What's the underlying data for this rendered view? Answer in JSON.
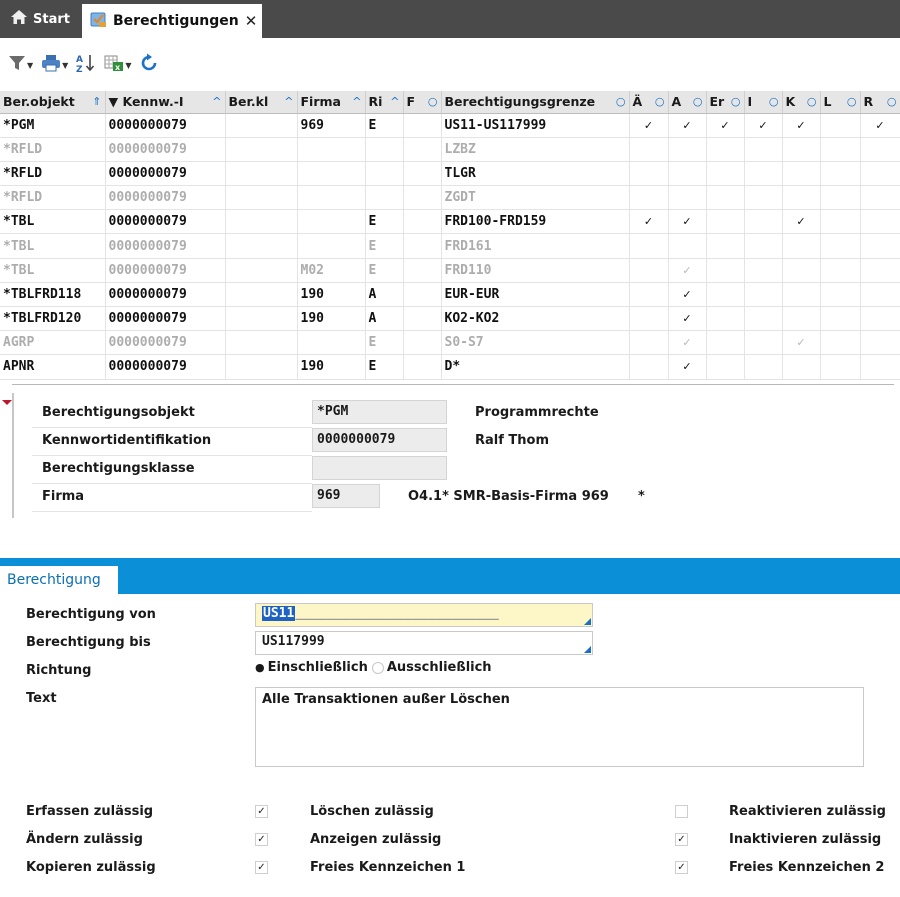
{
  "tabs": {
    "start_label": "Start",
    "active_label": "Berechtigungen",
    "close_glyph": "✕"
  },
  "toolbar": {
    "icons": [
      "filter-icon",
      "print-icon",
      "sort-az-icon",
      "export-excel-icon",
      "refresh-icon"
    ]
  },
  "grid": {
    "columns": [
      "Ber.objekt",
      "Kennw.-I",
      "Ber.kl",
      "Firma",
      "Ri",
      "F",
      "Berechtigungsgrenze",
      "Ä",
      "A",
      "Er",
      "I",
      "K",
      "L",
      "R"
    ],
    "rows": [
      {
        "obj": "*PGM",
        "kennw": "0000000079",
        "berkl": "",
        "firma": "969",
        "ri": "E",
        "f": "",
        "grenze": "US11-US117999",
        "chk": [
          "✓",
          "✓",
          "✓",
          "✓",
          "✓",
          "",
          "✓"
        ],
        "dim": false
      },
      {
        "obj": "*RFLD",
        "kennw": "0000000079",
        "berkl": "",
        "firma": "",
        "ri": "",
        "f": "",
        "grenze": "LZBZ",
        "chk": [
          "",
          "",
          "",
          "",
          "",
          "",
          ""
        ],
        "dim": true
      },
      {
        "obj": "*RFLD",
        "kennw": "0000000079",
        "berkl": "",
        "firma": "",
        "ri": "",
        "f": "",
        "grenze": "TLGR",
        "chk": [
          "",
          "",
          "",
          "",
          "",
          "",
          ""
        ],
        "dim": false
      },
      {
        "obj": "*RFLD",
        "kennw": "0000000079",
        "berkl": "",
        "firma": "",
        "ri": "",
        "f": "",
        "grenze": "ZGDT",
        "chk": [
          "",
          "",
          "",
          "",
          "",
          "",
          ""
        ],
        "dim": true
      },
      {
        "obj": "*TBL",
        "kennw": "0000000079",
        "berkl": "",
        "firma": "",
        "ri": "E",
        "f": "",
        "grenze": "FRD100-FRD159",
        "chk": [
          "✓",
          "✓",
          "",
          "",
          "✓",
          "",
          ""
        ],
        "dim": false
      },
      {
        "obj": "*TBL",
        "kennw": "0000000079",
        "berkl": "",
        "firma": "",
        "ri": "E",
        "f": "",
        "grenze": "FRD161",
        "chk": [
          "",
          "",
          "",
          "",
          "",
          "",
          ""
        ],
        "dim": true
      },
      {
        "obj": "*TBL",
        "kennw": "0000000079",
        "berkl": "",
        "firma": "M02",
        "ri": "E",
        "f": "",
        "grenze": "FRD110",
        "chk": [
          "",
          "✓",
          "",
          "",
          "",
          "",
          ""
        ],
        "dim": true
      },
      {
        "obj": "*TBLFRD118",
        "kennw": "0000000079",
        "berkl": "",
        "firma": "190",
        "ri": "A",
        "f": "",
        "grenze": "EUR-EUR",
        "chk": [
          "",
          "✓",
          "",
          "",
          "",
          "",
          ""
        ],
        "dim": false
      },
      {
        "obj": "*TBLFRD120",
        "kennw": "0000000079",
        "berkl": "",
        "firma": "190",
        "ri": "A",
        "f": "",
        "grenze": "KO2-KO2",
        "chk": [
          "",
          "✓",
          "",
          "",
          "",
          "",
          ""
        ],
        "dim": false
      },
      {
        "obj": "AGRP",
        "kennw": "0000000079",
        "berkl": "",
        "firma": "",
        "ri": "E",
        "f": "",
        "grenze": "S0-S7",
        "chk": [
          "",
          "✓",
          "",
          "",
          "✓",
          "",
          ""
        ],
        "dim": true
      },
      {
        "obj": "APNR",
        "kennw": "0000000079",
        "berkl": "",
        "firma": "190",
        "ri": "E",
        "f": "",
        "grenze": "D*",
        "chk": [
          "",
          "✓",
          "",
          "",
          "",
          "",
          ""
        ],
        "dim": false
      }
    ]
  },
  "detail": {
    "obj_label": "Berechtigungsobjekt",
    "obj_value": "*PGM",
    "obj_desc": "Programmrechte",
    "kennw_label": "Kennwortidentifikation",
    "kennw_value": "0000000079",
    "kennw_desc": "Ralf Thom",
    "berkl_label": "Berechtigungsklasse",
    "berkl_value": "",
    "firma_label": "Firma",
    "firma_value": "969",
    "firma_desc": "O4.1* SMR-Basis-Firma 969",
    "firma_star": "*"
  },
  "berechtigung": {
    "tab_label": "Berechtigung",
    "von_label": "Berechtigung von",
    "von_value": "US11",
    "von_fill": "__________________________",
    "bis_label": "Berechtigung bis",
    "bis_value": "US117999",
    "richtung_label": "Richtung",
    "richtung_opt1": "Einschließlich",
    "richtung_opt2": "Ausschließlich",
    "richtung_selected": "Einschließlich",
    "text_label": "Text",
    "text_value": "Alle Transaktionen außer Löschen",
    "flags": {
      "erfassen": "Erfassen zulässig",
      "aendern": "Ändern zulässig",
      "kopieren": "Kopieren zulässig",
      "loeschen": "Löschen zulässig",
      "anzeigen": "Anzeigen zulässig",
      "frei1": "Freies Kennzeichen 1",
      "reaktivieren": "Reaktivieren zulässig",
      "inaktivieren": "Inaktivieren zulässig",
      "frei2": "Freies Kennzeichen 2"
    },
    "flag_values": {
      "erfassen": "✓",
      "aendern": "✓",
      "kopieren": "✓",
      "loeschen": "",
      "anzeigen": "✓",
      "frei1": "✓"
    }
  },
  "colors": {
    "tabbar": "#4a4a4a",
    "accent_blue": "#0b8fd6",
    "selection": "#1e63c4",
    "input_yellow": "#fdf7c8",
    "marker_red": "#c0152a"
  }
}
